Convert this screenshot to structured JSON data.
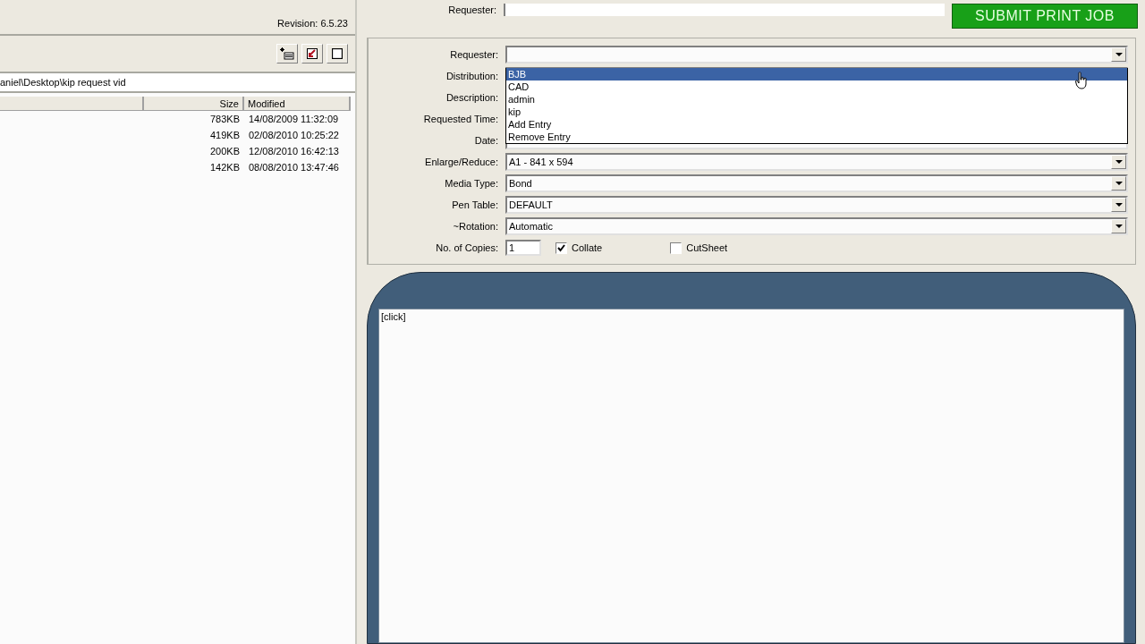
{
  "left_panel": {
    "revision": "Revision: 6.5.23",
    "path": "aniel\\Desktop\\kip request vid",
    "table": {
      "columns": [
        "",
        "Size",
        "Modified"
      ],
      "rows": [
        [
          "",
          "783KB",
          "14/08/2009 11:32:09"
        ],
        [
          "",
          "419KB",
          "02/08/2010 10:25:22"
        ],
        [
          "",
          "200KB",
          "12/08/2010 16:42:13"
        ],
        [
          "",
          "142KB",
          "08/08/2010 13:47:46"
        ]
      ]
    }
  },
  "top_strip": {
    "label": "Requester:",
    "submit_button": "SUBMIT PRINT JOB"
  },
  "form": {
    "rows": [
      {
        "label": "Requester:",
        "kind": "dropdown"
      },
      {
        "label": "Distribution:",
        "kind": "covered"
      },
      {
        "label": "Description:",
        "kind": "covered"
      },
      {
        "label": "Requested Time:",
        "kind": "covered"
      },
      {
        "label": "Date:",
        "kind": "text"
      },
      {
        "label": "Enlarge/Reduce:",
        "kind": "dropdown",
        "value": "A1 - 841 x 594"
      },
      {
        "label": "Media Type:",
        "kind": "dropdown",
        "value": "Bond"
      },
      {
        "label": "Pen Table:",
        "kind": "dropdown",
        "value": "DEFAULT"
      },
      {
        "label": "~Rotation:",
        "kind": "dropdown",
        "value": "Automatic"
      }
    ],
    "copies": {
      "label": "No. of Copies:",
      "value": "1"
    },
    "checkboxes": [
      {
        "label": "Collate",
        "checked": true
      },
      {
        "label": "CutSheet",
        "checked": false
      }
    ],
    "dropdown_list": [
      {
        "label": "BJB",
        "selected": true
      },
      {
        "label": "CAD",
        "selected": false
      },
      {
        "label": "admin",
        "selected": false
      },
      {
        "label": "kip",
        "selected": false
      },
      {
        "label": "Add Entry",
        "selected": false
      },
      {
        "label": "Remove Entry",
        "selected": false
      }
    ]
  },
  "preview": {
    "hint": "[click]"
  }
}
